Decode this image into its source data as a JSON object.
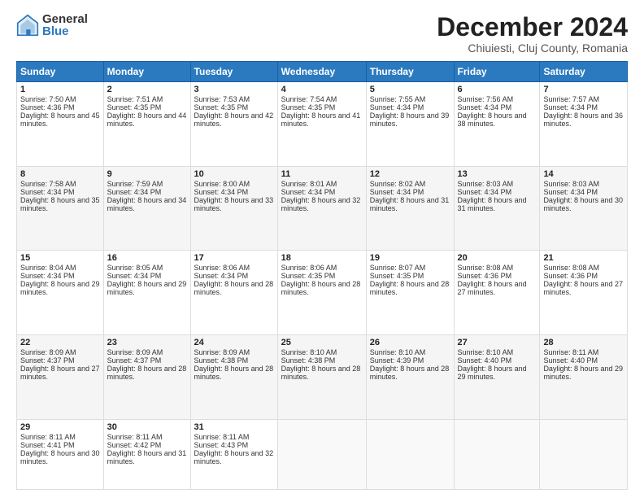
{
  "logo": {
    "general": "General",
    "blue": "Blue"
  },
  "header": {
    "month": "December 2024",
    "location": "Chiuiesti, Cluj County, Romania"
  },
  "weekdays": [
    "Sunday",
    "Monday",
    "Tuesday",
    "Wednesday",
    "Thursday",
    "Friday",
    "Saturday"
  ],
  "weeks": [
    [
      {
        "day": 1,
        "sunrise": "7:50 AM",
        "sunset": "4:36 PM",
        "daylight": "8 hours and 45 minutes."
      },
      {
        "day": 2,
        "sunrise": "7:51 AM",
        "sunset": "4:35 PM",
        "daylight": "8 hours and 44 minutes."
      },
      {
        "day": 3,
        "sunrise": "7:53 AM",
        "sunset": "4:35 PM",
        "daylight": "8 hours and 42 minutes."
      },
      {
        "day": 4,
        "sunrise": "7:54 AM",
        "sunset": "4:35 PM",
        "daylight": "8 hours and 41 minutes."
      },
      {
        "day": 5,
        "sunrise": "7:55 AM",
        "sunset": "4:34 PM",
        "daylight": "8 hours and 39 minutes."
      },
      {
        "day": 6,
        "sunrise": "7:56 AM",
        "sunset": "4:34 PM",
        "daylight": "8 hours and 38 minutes."
      },
      {
        "day": 7,
        "sunrise": "7:57 AM",
        "sunset": "4:34 PM",
        "daylight": "8 hours and 36 minutes."
      }
    ],
    [
      {
        "day": 8,
        "sunrise": "7:58 AM",
        "sunset": "4:34 PM",
        "daylight": "8 hours and 35 minutes."
      },
      {
        "day": 9,
        "sunrise": "7:59 AM",
        "sunset": "4:34 PM",
        "daylight": "8 hours and 34 minutes."
      },
      {
        "day": 10,
        "sunrise": "8:00 AM",
        "sunset": "4:34 PM",
        "daylight": "8 hours and 33 minutes."
      },
      {
        "day": 11,
        "sunrise": "8:01 AM",
        "sunset": "4:34 PM",
        "daylight": "8 hours and 32 minutes."
      },
      {
        "day": 12,
        "sunrise": "8:02 AM",
        "sunset": "4:34 PM",
        "daylight": "8 hours and 31 minutes."
      },
      {
        "day": 13,
        "sunrise": "8:03 AM",
        "sunset": "4:34 PM",
        "daylight": "8 hours and 31 minutes."
      },
      {
        "day": 14,
        "sunrise": "8:03 AM",
        "sunset": "4:34 PM",
        "daylight": "8 hours and 30 minutes."
      }
    ],
    [
      {
        "day": 15,
        "sunrise": "8:04 AM",
        "sunset": "4:34 PM",
        "daylight": "8 hours and 29 minutes."
      },
      {
        "day": 16,
        "sunrise": "8:05 AM",
        "sunset": "4:34 PM",
        "daylight": "8 hours and 29 minutes."
      },
      {
        "day": 17,
        "sunrise": "8:06 AM",
        "sunset": "4:34 PM",
        "daylight": "8 hours and 28 minutes."
      },
      {
        "day": 18,
        "sunrise": "8:06 AM",
        "sunset": "4:35 PM",
        "daylight": "8 hours and 28 minutes."
      },
      {
        "day": 19,
        "sunrise": "8:07 AM",
        "sunset": "4:35 PM",
        "daylight": "8 hours and 28 minutes."
      },
      {
        "day": 20,
        "sunrise": "8:08 AM",
        "sunset": "4:36 PM",
        "daylight": "8 hours and 27 minutes."
      },
      {
        "day": 21,
        "sunrise": "8:08 AM",
        "sunset": "4:36 PM",
        "daylight": "8 hours and 27 minutes."
      }
    ],
    [
      {
        "day": 22,
        "sunrise": "8:09 AM",
        "sunset": "4:37 PM",
        "daylight": "8 hours and 27 minutes."
      },
      {
        "day": 23,
        "sunrise": "8:09 AM",
        "sunset": "4:37 PM",
        "daylight": "8 hours and 28 minutes."
      },
      {
        "day": 24,
        "sunrise": "8:09 AM",
        "sunset": "4:38 PM",
        "daylight": "8 hours and 28 minutes."
      },
      {
        "day": 25,
        "sunrise": "8:10 AM",
        "sunset": "4:38 PM",
        "daylight": "8 hours and 28 minutes."
      },
      {
        "day": 26,
        "sunrise": "8:10 AM",
        "sunset": "4:39 PM",
        "daylight": "8 hours and 28 minutes."
      },
      {
        "day": 27,
        "sunrise": "8:10 AM",
        "sunset": "4:40 PM",
        "daylight": "8 hours and 29 minutes."
      },
      {
        "day": 28,
        "sunrise": "8:11 AM",
        "sunset": "4:40 PM",
        "daylight": "8 hours and 29 minutes."
      }
    ],
    [
      {
        "day": 29,
        "sunrise": "8:11 AM",
        "sunset": "4:41 PM",
        "daylight": "8 hours and 30 minutes."
      },
      {
        "day": 30,
        "sunrise": "8:11 AM",
        "sunset": "4:42 PM",
        "daylight": "8 hours and 31 minutes."
      },
      {
        "day": 31,
        "sunrise": "8:11 AM",
        "sunset": "4:43 PM",
        "daylight": "8 hours and 32 minutes."
      },
      null,
      null,
      null,
      null
    ]
  ]
}
